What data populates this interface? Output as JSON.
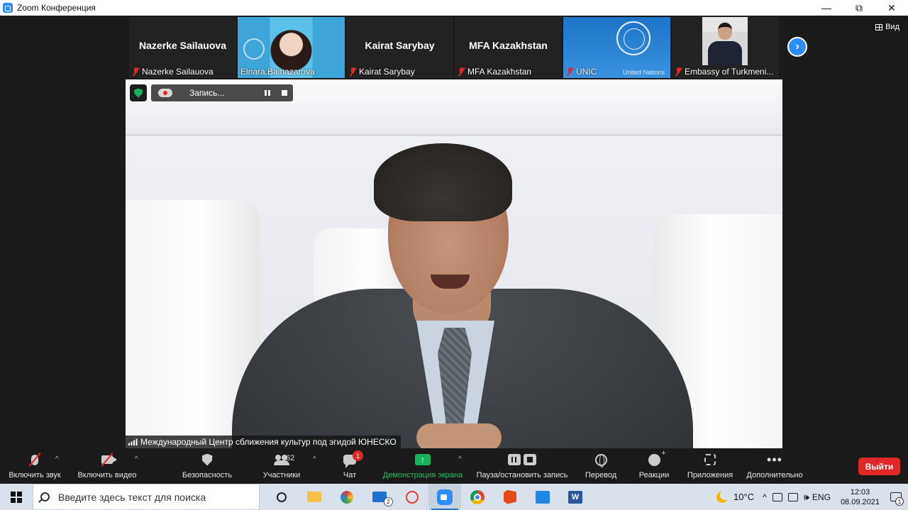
{
  "window": {
    "title": "Zoom Конференция",
    "minimize": "—",
    "maximize": "⧉",
    "close": "✕"
  },
  "view_button": "Вид",
  "participants": [
    {
      "big_name": "Nazerke Sailauova",
      "label": "Nazerke Sailauova",
      "muted": true
    },
    {
      "big_name": "",
      "label": "Elnara.Bainazarova",
      "muted": false
    },
    {
      "big_name": "Kairat Sarybay",
      "label": "Kairat Sarybay",
      "muted": true
    },
    {
      "big_name": "MFA Kazakhstan",
      "label": "MFA Kazakhstan",
      "muted": true
    },
    {
      "big_name": "",
      "label": "UNIC",
      "muted": true,
      "background_text": "United Nations"
    },
    {
      "big_name": "",
      "label": "Embassy of Turkmeni...",
      "muted": true
    }
  ],
  "recording": {
    "label": "Запись..."
  },
  "main_video": {
    "caption": "Международный Центр сближения культур под эгидой ЮНЕСКО"
  },
  "toolbar": {
    "unmute": "Включить звук",
    "start_video": "Включить видео",
    "security": "Безопасность",
    "participants": "Участники",
    "participants_count": "62",
    "chat": "Чат",
    "chat_badge": "1",
    "share_screen": "Демонстрация экрана",
    "pause_stop_recording": "Пауза/остановить запись",
    "interpretation": "Перевод",
    "reactions": "Реакции",
    "apps": "Приложения",
    "more": "Дополнительно",
    "leave": "Выйти"
  },
  "taskbar": {
    "search_placeholder": "Введите здесь текст для поиска",
    "mail_badge": "2",
    "word_letter": "W",
    "temperature": "10°C",
    "language": "ENG",
    "time": "12:03",
    "date": "08.09.2021",
    "notification_count": "1"
  },
  "colors": {
    "zoom_blue": "#2d8cff",
    "leave_red": "#e02828",
    "share_green": "#16b35b",
    "toolbar_bg": "#1a1a1a"
  }
}
